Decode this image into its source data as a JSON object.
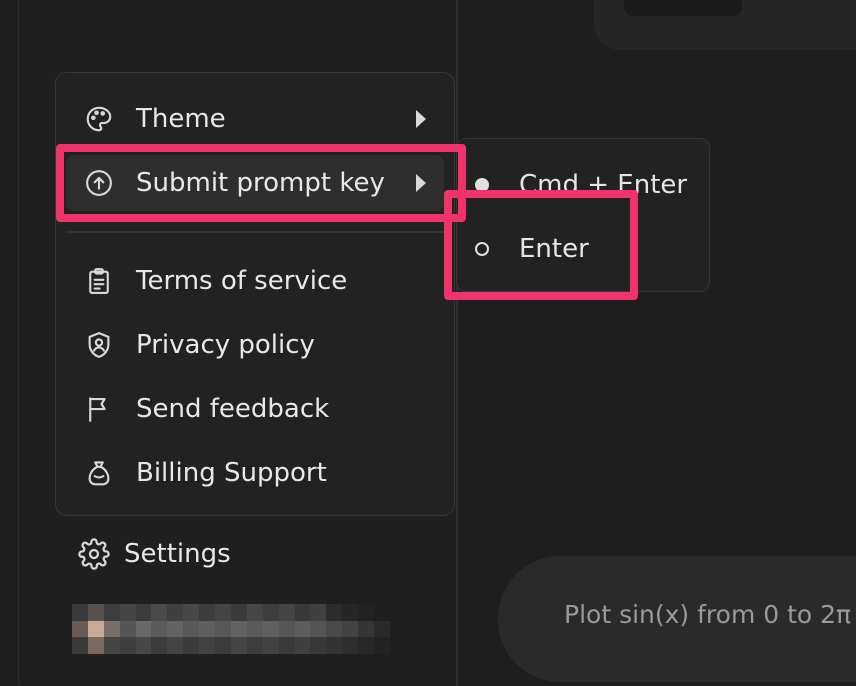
{
  "menu": {
    "items": [
      {
        "label": "Theme",
        "icon": "palette-icon",
        "has_submenu": true
      },
      {
        "label": "Submit prompt key",
        "icon": "arrow-up-circle-icon",
        "has_submenu": true
      },
      {
        "label": "Terms of service",
        "icon": "clipboard-icon",
        "has_submenu": false
      },
      {
        "label": "Privacy policy",
        "icon": "shield-icon",
        "has_submenu": false
      },
      {
        "label": "Send feedback",
        "icon": "flag-icon",
        "has_submenu": false
      },
      {
        "label": "Billing Support",
        "icon": "money-bag-icon",
        "has_submenu": false
      }
    ]
  },
  "submenu": {
    "options": [
      {
        "label": "Cmd + Enter",
        "selected": true
      },
      {
        "label": "Enter",
        "selected": false
      }
    ]
  },
  "settings": {
    "label": "Settings",
    "icon": "gear-icon"
  },
  "prompt": {
    "text": "Plot sin(x) from 0 to 2π"
  },
  "colors": {
    "highlight": "#f0336b",
    "background": "#1e1e1e",
    "menu_bg": "#222222",
    "text": "#e8e8e8"
  }
}
